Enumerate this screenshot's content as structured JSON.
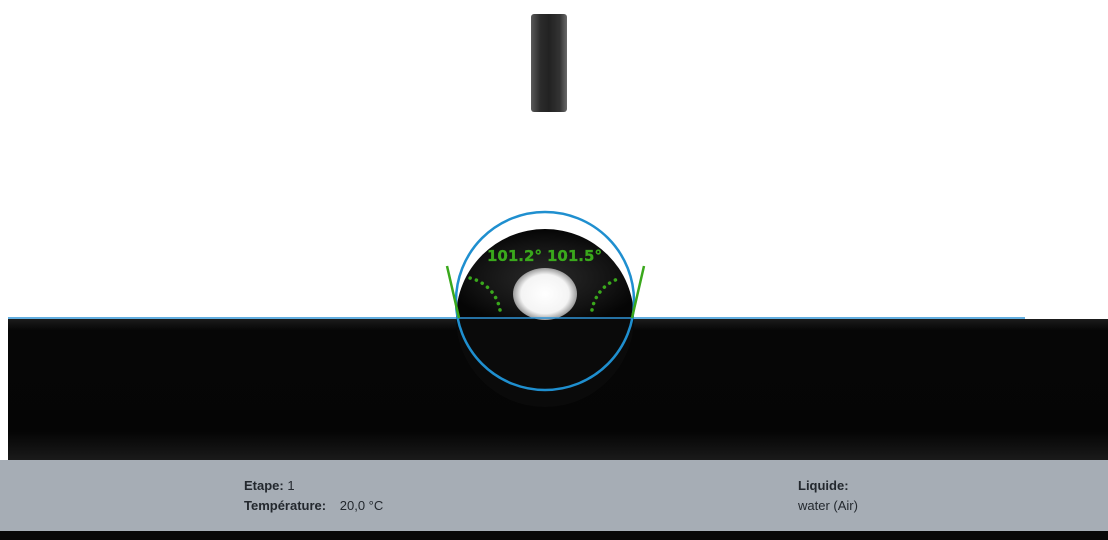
{
  "measurement": {
    "left_contact_angle": "101.2°",
    "right_contact_angle": "101.5°",
    "colors": {
      "angle_indicator": "#3aa81c",
      "fit_circle": "#1f8fcf",
      "baseline": "#2f93d6"
    }
  },
  "info_bar": {
    "step_label": "Etape:",
    "step_value": "1",
    "temperature_label": "Température:",
    "temperature_value": "20,0 °C",
    "liquid_label": "Liquide:",
    "liquid_value": "water (Air)"
  }
}
